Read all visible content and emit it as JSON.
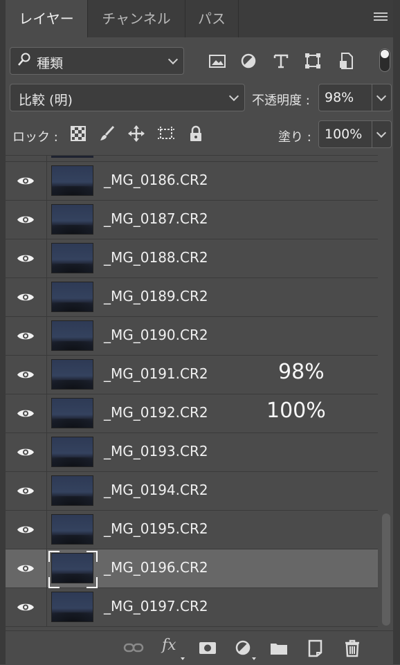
{
  "tabs": [
    {
      "label": "レイヤー",
      "active": true
    },
    {
      "label": "チャンネル",
      "active": false
    },
    {
      "label": "パス",
      "active": false
    }
  ],
  "filter": {
    "search_glyph": "⌕",
    "kind_label": "種類",
    "icons": [
      "image-filter-icon",
      "adjustment-filter-icon",
      "type-filter-icon",
      "shape-filter-icon",
      "smart-object-filter-icon"
    ]
  },
  "blend": {
    "mode": "比較 (明)",
    "opacity_label": "不透明度 :",
    "opacity_value": "98%"
  },
  "lock": {
    "label": "ロック :",
    "fill_label": "塗り :",
    "fill_value": "100%"
  },
  "layers": [
    {
      "name": "_MG_0186.CR2",
      "visible": true,
      "selected": false
    },
    {
      "name": "_MG_0187.CR2",
      "visible": true,
      "selected": false
    },
    {
      "name": "_MG_0188.CR2",
      "visible": true,
      "selected": false
    },
    {
      "name": "_MG_0189.CR2",
      "visible": true,
      "selected": false
    },
    {
      "name": "_MG_0190.CR2",
      "visible": true,
      "selected": false
    },
    {
      "name": "_MG_0191.CR2",
      "visible": true,
      "selected": false
    },
    {
      "name": "_MG_0192.CR2",
      "visible": true,
      "selected": false
    },
    {
      "name": "_MG_0193.CR2",
      "visible": true,
      "selected": false
    },
    {
      "name": "_MG_0194.CR2",
      "visible": true,
      "selected": false
    },
    {
      "name": "_MG_0195.CR2",
      "visible": true,
      "selected": false
    },
    {
      "name": "_MG_0196.CR2",
      "visible": true,
      "selected": true
    },
    {
      "name": "_MG_0197.CR2",
      "visible": true,
      "selected": false
    }
  ],
  "overlay_annotations": [
    "98%",
    "100%"
  ],
  "footer": {
    "fx_label": "fx"
  }
}
